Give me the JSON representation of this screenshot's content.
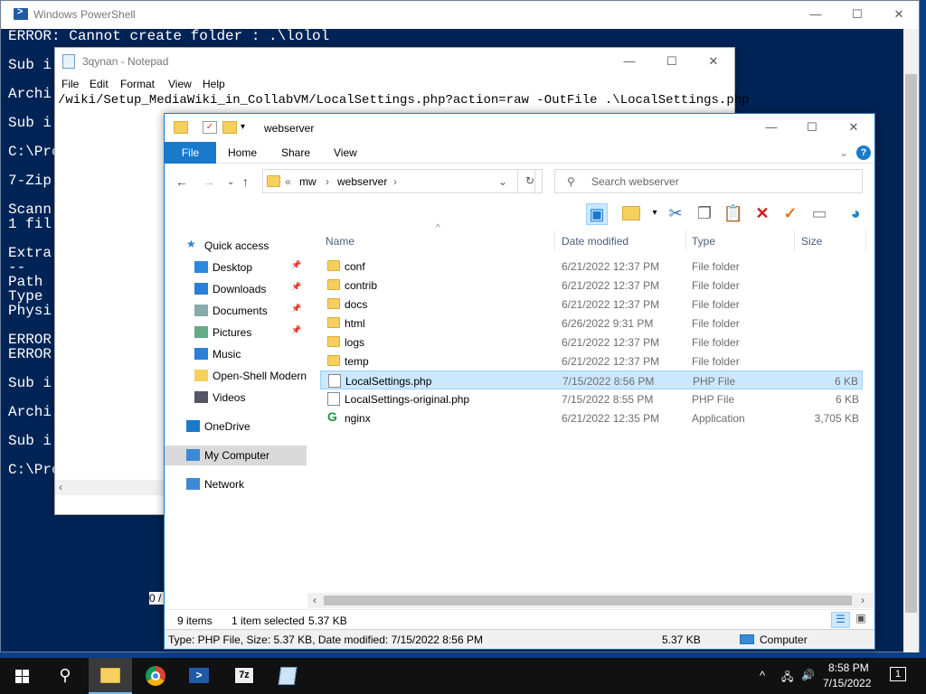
{
  "powershell": {
    "title": "Windows PowerShell",
    "lines": [
      "ERROR: Cannot create folder : .\\lolol",
      "",
      "Sub i",
      "",
      "Archi",
      "",
      "Sub i",
      "",
      "C:\\Pro",
      "",
      "7-Zip",
      "",
      "Scann",
      "1 fil",
      "",
      "Extra",
      "--",
      "Path",
      "Type",
      "Physi",
      "",
      "ERROR",
      "ERROR",
      "",
      "Sub i",
      "",
      "Archi",
      "",
      "Sub i",
      "",
      "C:\\Pro"
    ],
    "minimize": "—",
    "maximize": "☐",
    "close": "✕"
  },
  "notepad": {
    "title": "3qynan - Notepad",
    "menu": [
      "File",
      "Edit",
      "Format",
      "View",
      "Help"
    ],
    "text": "/wiki/Setup_MediaWiki_in_CollabVM/LocalSettings.php?action=raw -OutFile .\\LocalSettings.php",
    "status_fragment": "0 /",
    "minimize": "—",
    "maximize": "☐",
    "close": "✕"
  },
  "explorer": {
    "title": "webserver",
    "ribbon_tabs": [
      "File",
      "Home",
      "Share",
      "View"
    ],
    "breadcrumb": [
      "«",
      "mw",
      "›",
      "webserver",
      "›"
    ],
    "search_placeholder": "Search webserver",
    "minimize": "—",
    "maximize": "☐",
    "close": "✕",
    "nav": [
      {
        "label": "Quick access",
        "icon": "star-icon"
      },
      {
        "label": "Desktop",
        "icon": "desktop-icon",
        "pinned": true
      },
      {
        "label": "Downloads",
        "icon": "download-icon",
        "pinned": true
      },
      {
        "label": "Documents",
        "icon": "documents-icon",
        "pinned": true
      },
      {
        "label": "Pictures",
        "icon": "pictures-icon",
        "pinned": true
      },
      {
        "label": "Music",
        "icon": "music-icon"
      },
      {
        "label": "Open-Shell Modern",
        "icon": "folder-icon"
      },
      {
        "label": "Videos",
        "icon": "videos-icon"
      },
      {
        "label": "OneDrive",
        "icon": "cloud-icon"
      },
      {
        "label": "My Computer",
        "icon": "computer-icon",
        "selected": true
      },
      {
        "label": "Network",
        "icon": "network-icon"
      }
    ],
    "columns": [
      "Name",
      "Date modified",
      "Type",
      "Size"
    ],
    "files": [
      {
        "name": "conf",
        "date": "6/21/2022 12:37 PM",
        "type": "File folder",
        "size": "",
        "icon": "folder-icon"
      },
      {
        "name": "contrib",
        "date": "6/21/2022 12:37 PM",
        "type": "File folder",
        "size": "",
        "icon": "folder-icon"
      },
      {
        "name": "docs",
        "date": "6/21/2022 12:37 PM",
        "type": "File folder",
        "size": "",
        "icon": "folder-icon"
      },
      {
        "name": "html",
        "date": "6/26/2022 9:31 PM",
        "type": "File folder",
        "size": "",
        "icon": "folder-icon"
      },
      {
        "name": "logs",
        "date": "6/21/2022 12:37 PM",
        "type": "File folder",
        "size": "",
        "icon": "folder-icon"
      },
      {
        "name": "temp",
        "date": "6/21/2022 12:37 PM",
        "type": "File folder",
        "size": "",
        "icon": "folder-icon"
      },
      {
        "name": "LocalSettings.php",
        "date": "7/15/2022 8:56 PM",
        "type": "PHP File",
        "size": "6 KB",
        "icon": "file-icon",
        "selected": true
      },
      {
        "name": "LocalSettings-original.php",
        "date": "7/15/2022 8:55 PM",
        "type": "PHP File",
        "size": "6 KB",
        "icon": "file-icon"
      },
      {
        "name": "nginx",
        "date": "6/21/2022 12:35 PM",
        "type": "Application",
        "size": "3,705 KB",
        "icon": "nginx-icon"
      }
    ],
    "status": {
      "items": "9 items",
      "selected": "1 item selected",
      "size": "5.37 KB"
    },
    "details": {
      "text": "Type: PHP File, Size: 5.37 KB, Date modified: 7/15/2022 8:56 PM",
      "size": "5.37 KB",
      "location": "Computer"
    }
  },
  "taskbar": {
    "time": "8:58 PM",
    "date": "7/15/2022",
    "notification_count": "1"
  },
  "colors": {
    "desktop": "#0c3f86",
    "powershell_bg": "#012456",
    "accent": "#1979ca",
    "selection": "#cce8ff"
  }
}
